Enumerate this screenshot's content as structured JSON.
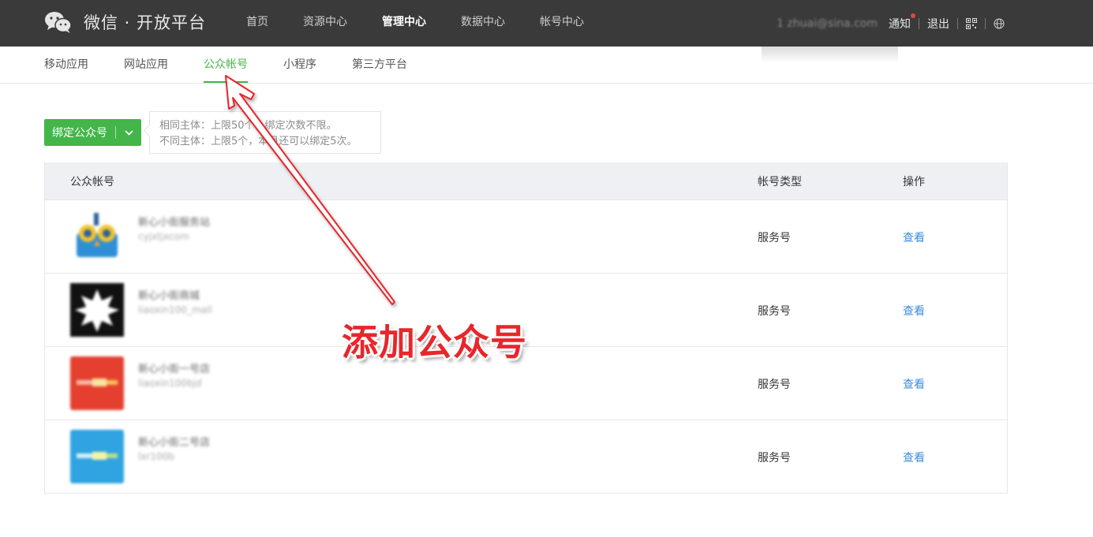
{
  "brand": {
    "name": "微信 · 开放平台",
    "icon": "wechat-logo-icon"
  },
  "main_nav": [
    {
      "label": "首页",
      "active": false
    },
    {
      "label": "资源中心",
      "active": false
    },
    {
      "label": "管理中心",
      "active": true
    },
    {
      "label": "数据中心",
      "active": false
    },
    {
      "label": "帐号中心",
      "active": false
    }
  ],
  "user": {
    "email": "1 zhuai@sina.com",
    "notify_label": "通知",
    "logout_label": "退出"
  },
  "sub_nav": [
    {
      "label": "移动应用",
      "active": false
    },
    {
      "label": "网站应用",
      "active": false
    },
    {
      "label": "公众帐号",
      "active": true
    },
    {
      "label": "小程序",
      "active": false
    },
    {
      "label": "第三方平台",
      "active": false
    }
  ],
  "bind_button": {
    "label": "绑定公众号"
  },
  "tip": {
    "line1": "相同主体：上限50个，绑定次数不限。",
    "line2": "不同主体：上限5个，本月还可以绑定5次。"
  },
  "table": {
    "headers": [
      "公众帐号",
      "帐号类型",
      "操作"
    ],
    "rows": [
      {
        "name": "新心小街服务站",
        "id": "cyjxtjxcom",
        "type": "服务号",
        "action": "查看",
        "color": "#2d8fd6"
      },
      {
        "name": "新心小街商城",
        "id": "liaoxin100_mall",
        "type": "服务号",
        "action": "查看",
        "color": "#111111"
      },
      {
        "name": "新心小街一号店",
        "id": "liaoxin100bjd",
        "type": "服务号",
        "action": "查看",
        "color": "#e5402f"
      },
      {
        "name": "新心小街二号店",
        "id": "lxr100b",
        "type": "服务号",
        "action": "查看",
        "color": "#2fa4e0"
      }
    ]
  },
  "annotation": {
    "text": "添加公众号",
    "color": "#e8262b"
  },
  "colors": {
    "topbar": "#3a3a3a",
    "accent": "#44b549",
    "link": "#3c8ddc"
  }
}
